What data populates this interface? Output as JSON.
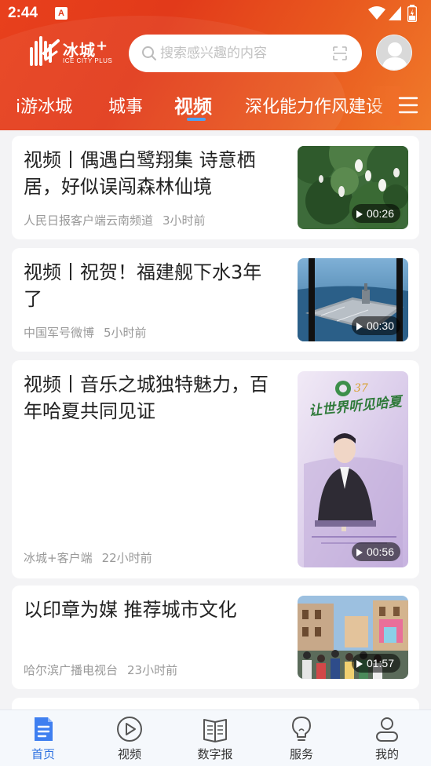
{
  "status_bar": {
    "time": "2:44",
    "notification_glyph": "A"
  },
  "brand": {
    "name": "冰城",
    "plus": "+",
    "subtitle": "ICE CITY PLUS"
  },
  "search": {
    "placeholder": "搜索感兴趣的内容"
  },
  "tabs": [
    {
      "label": "i游冰城"
    },
    {
      "label": "城事"
    },
    {
      "label": "视频",
      "active": true
    },
    {
      "label": "深化能力作风建设"
    }
  ],
  "articles": [
    {
      "title": "视频丨偶遇白鹭翔集 诗意栖居，好似误闯森林仙境",
      "source": "人民日报客户端云南频道",
      "time": "3小时前",
      "duration": "00:26",
      "thumb_theme": "egrets-forest"
    },
    {
      "title": "视频丨祝贺！福建舰下水3年了",
      "source": "中国军号微博",
      "time": "5小时前",
      "duration": "00:30",
      "thumb_theme": "aircraft-carrier"
    },
    {
      "title": "视频丨音乐之城独特魅力，百年哈夏共同见证",
      "source": "冰城+客户端",
      "time": "22小时前",
      "duration": "00:56",
      "thumb_theme": "concert-poster",
      "thumb_heading": "让世界听见哈夏"
    },
    {
      "title": "以印章为媒 推荐城市文化",
      "source": "哈尔滨广播电视台",
      "time": "23小时前",
      "duration": "01:57",
      "thumb_theme": "street-crowd"
    }
  ],
  "bottom_nav": [
    {
      "label": "首页",
      "icon": "document-icon",
      "active": true
    },
    {
      "label": "视频",
      "icon": "play-circle-icon"
    },
    {
      "label": "数字报",
      "icon": "newspaper-icon"
    },
    {
      "label": "服务",
      "icon": "lightbulb-icon"
    },
    {
      "label": "我的",
      "icon": "user-icon"
    }
  ],
  "colors": {
    "header": "#e23a1a",
    "accent": "#2b6fe0",
    "tab_underline": "#4fa0f0"
  }
}
